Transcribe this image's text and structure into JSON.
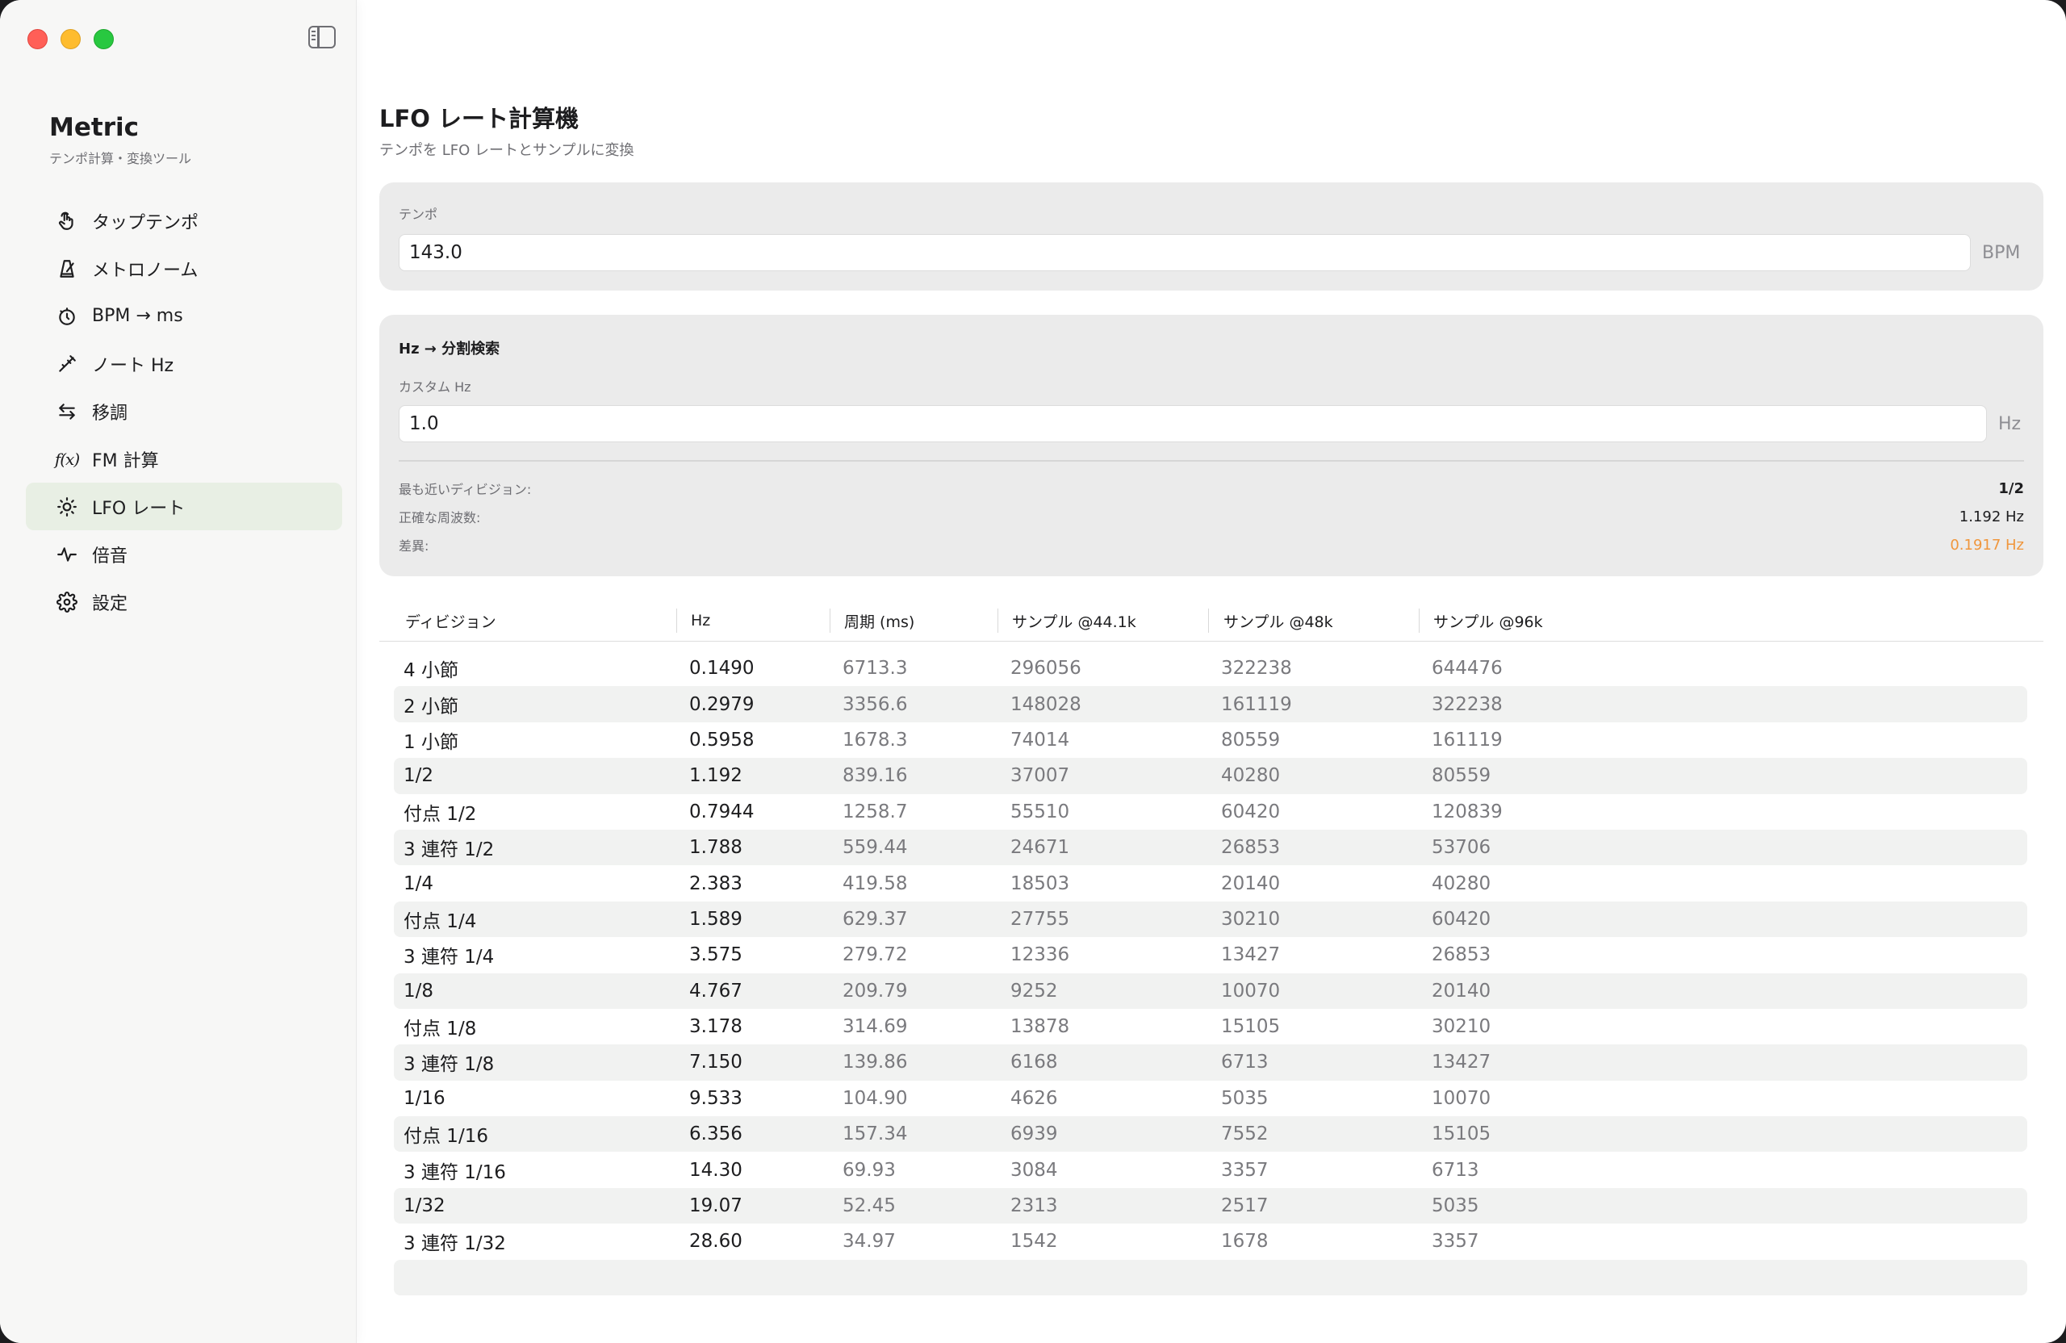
{
  "sidebar": {
    "app_title": "Metric",
    "app_subtitle": "テンポ計算・変換ツール",
    "items": [
      {
        "label": "タップテンポ",
        "icon": "tap-hand-icon",
        "active": false
      },
      {
        "label": "メトロノーム",
        "icon": "metronome-icon",
        "active": false
      },
      {
        "label": "BPM → ms",
        "icon": "timer-icon",
        "active": false
      },
      {
        "label": "ノート Hz",
        "icon": "tuning-fork-icon",
        "active": false
      },
      {
        "label": "移調",
        "icon": "transpose-arrows-icon",
        "active": false
      },
      {
        "label": "FM 計算",
        "icon": "function-icon",
        "active": false
      },
      {
        "label": "LFO レート",
        "icon": "lfo-sun-icon",
        "active": true
      },
      {
        "label": "倍音",
        "icon": "waveform-icon",
        "active": false
      },
      {
        "label": "設定",
        "icon": "gear-icon",
        "active": false
      }
    ]
  },
  "main": {
    "title": "LFO レート計算機",
    "subtitle": "テンポを LFO レートとサンプルに変換",
    "tempo": {
      "label": "テンポ",
      "value": "143.0",
      "unit": "BPM"
    },
    "search": {
      "heading": "Hz → 分割検索",
      "custom_label": "カスタム Hz",
      "custom_value": "1.0",
      "unit": "Hz",
      "nearest_label": "最も近いディビジョン:",
      "nearest_value": "1/2",
      "exact_label": "正確な周波数:",
      "exact_value": "1.192 Hz",
      "diff_label": "差異:",
      "diff_value": "0.1917 Hz"
    },
    "table": {
      "headers": [
        "ディビジョン",
        "Hz",
        "周期 (ms)",
        "サンプル @44.1k",
        "サンプル @48k",
        "サンプル @96k"
      ],
      "rows": [
        [
          "4 小節",
          "0.1490",
          "6713.3",
          "296056",
          "322238",
          "644476"
        ],
        [
          "2 小節",
          "0.2979",
          "3356.6",
          "148028",
          "161119",
          "322238"
        ],
        [
          "1 小節",
          "0.5958",
          "1678.3",
          "74014",
          "80559",
          "161119"
        ],
        [
          "1/2",
          "1.192",
          "839.16",
          "37007",
          "40280",
          "80559"
        ],
        [
          "付点 1/2",
          "0.7944",
          "1258.7",
          "55510",
          "60420",
          "120839"
        ],
        [
          "3 連符 1/2",
          "1.788",
          "559.44",
          "24671",
          "26853",
          "53706"
        ],
        [
          "1/4",
          "2.383",
          "419.58",
          "18503",
          "20140",
          "40280"
        ],
        [
          "付点 1/4",
          "1.589",
          "629.37",
          "27755",
          "30210",
          "60420"
        ],
        [
          "3 連符 1/4",
          "3.575",
          "279.72",
          "12336",
          "13427",
          "26853"
        ],
        [
          "1/8",
          "4.767",
          "209.79",
          "9252",
          "10070",
          "20140"
        ],
        [
          "付点 1/8",
          "3.178",
          "314.69",
          "13878",
          "15105",
          "30210"
        ],
        [
          "3 連符 1/8",
          "7.150",
          "139.86",
          "6168",
          "6713",
          "13427"
        ],
        [
          "1/16",
          "9.533",
          "104.90",
          "4626",
          "5035",
          "10070"
        ],
        [
          "付点 1/16",
          "6.356",
          "157.34",
          "6939",
          "7552",
          "15105"
        ],
        [
          "3 連符 1/16",
          "14.30",
          "69.93",
          "3084",
          "3357",
          "6713"
        ],
        [
          "1/32",
          "19.07",
          "52.45",
          "2313",
          "2517",
          "5035"
        ],
        [
          "3 連符 1/32",
          "28.60",
          "34.97",
          "1542",
          "1678",
          "3357"
        ]
      ]
    }
  },
  "colors": {
    "accent_active_bg": "#e8efe4",
    "diff_orange": "#f0963c",
    "traffic_red": "#ff5f57",
    "traffic_yellow": "#febc2e",
    "traffic_green": "#28c840"
  }
}
